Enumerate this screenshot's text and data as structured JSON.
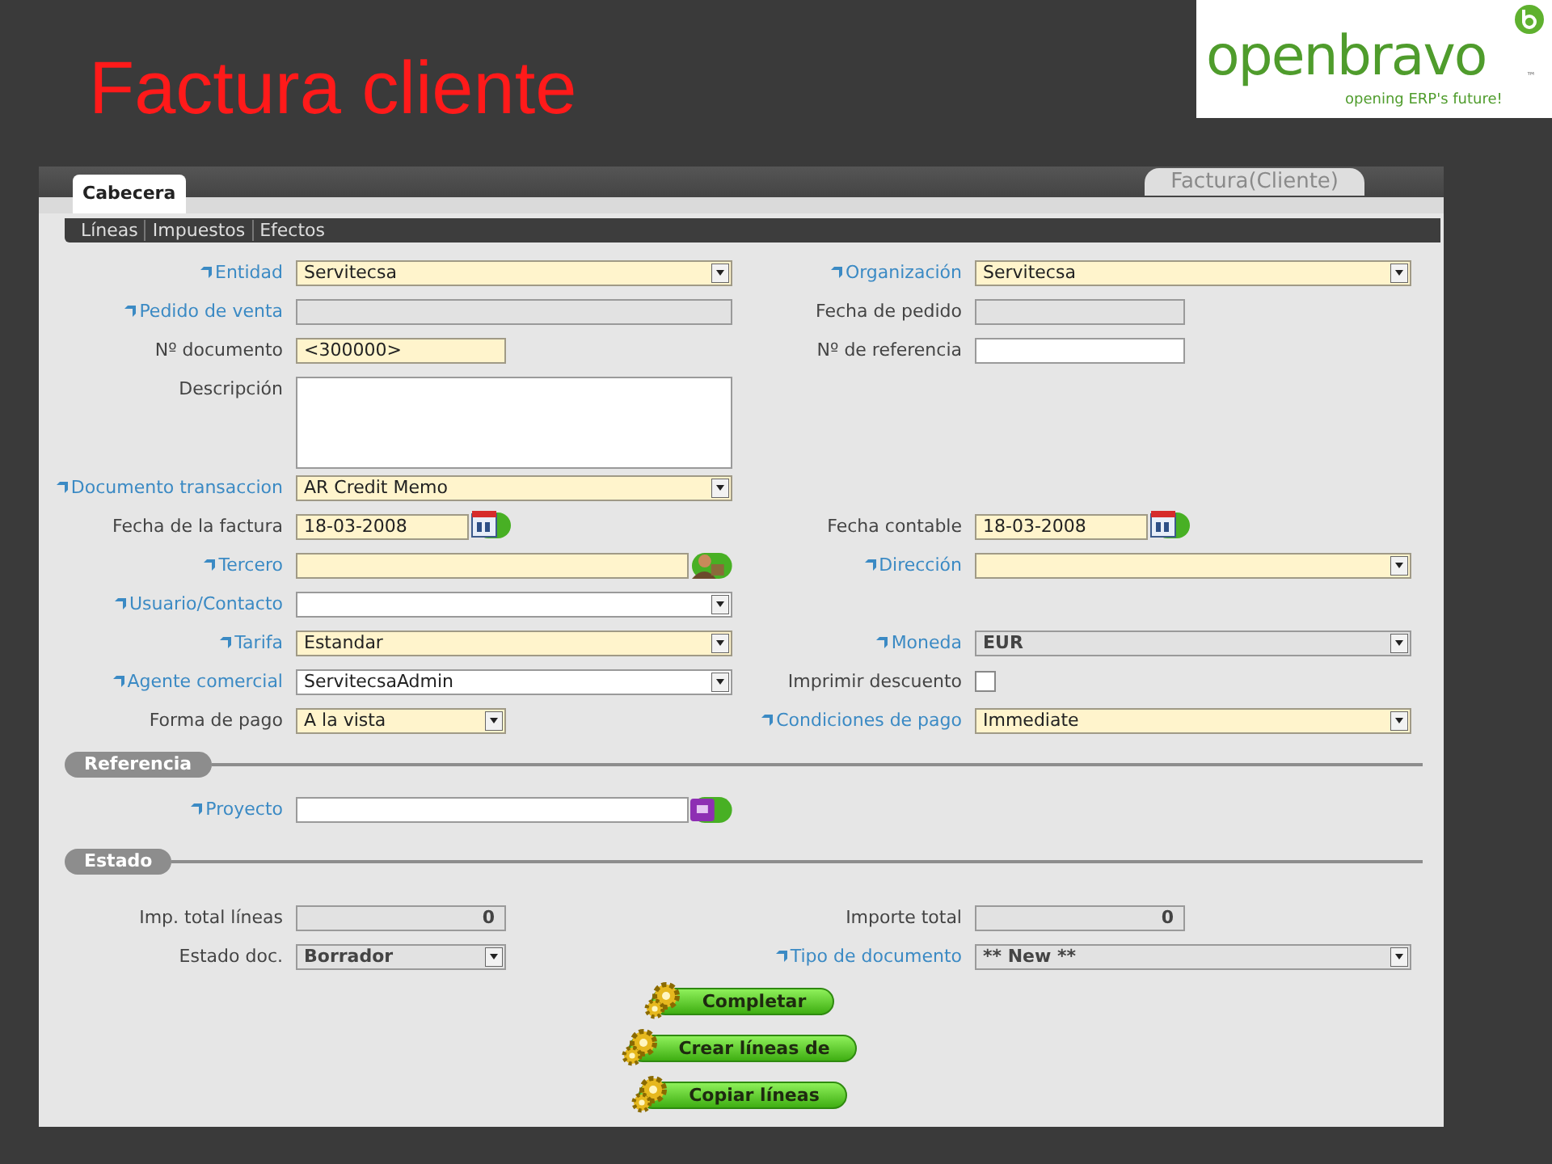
{
  "slide": {
    "title": "Factura cliente"
  },
  "logo": {
    "name": "openbravo",
    "trademark": "™",
    "tagline": "opening ERP's future!"
  },
  "window": {
    "tabs": [
      {
        "label": "Cabecera",
        "selected": true
      }
    ],
    "window_title": "Factura(Cliente)",
    "subtabs": [
      "Líneas",
      "Impuestos",
      "Efectos"
    ]
  },
  "sections": [
    {
      "rows": [
        {
          "left": {
            "label": "Entidad",
            "link": true,
            "kind": "select",
            "value": "Servitecsa",
            "mandatory": true,
            "readonly": false
          },
          "right": {
            "label": "Organización",
            "link": true,
            "kind": "select",
            "value": "Servitecsa",
            "mandatory": true,
            "readonly": false
          }
        },
        {
          "left": {
            "label": "Pedido de venta",
            "link": true,
            "kind": "text",
            "readonly": true
          },
          "right": {
            "label": "Fecha de pedido",
            "link": false,
            "kind": "text",
            "readonly": true
          }
        },
        {
          "left": {
            "label": "Nº documento",
            "link": false,
            "kind": "text",
            "value": "<300000>",
            "mandatory": true,
            "readonly": false
          },
          "right": {
            "label": "Nº de referencia",
            "link": false,
            "kind": "text",
            "mandatory": false,
            "readonly": false
          }
        },
        {
          "left": {
            "label": "Descripción",
            "link": false,
            "kind": "textarea",
            "mandatory": false,
            "readonly": false
          }
        },
        {
          "left": {
            "label": "Documento transaccion",
            "link": true,
            "kind": "select",
            "value": "AR Credit Memo",
            "mandatory": true,
            "readonly": false
          }
        },
        {
          "left": {
            "label": "Fecha de la factura",
            "link": false,
            "kind": "date",
            "value": "18-03-2008",
            "mandatory": true,
            "readonly": false
          },
          "right": {
            "label": "Fecha contable",
            "link": false,
            "kind": "date",
            "value": "18-03-2008",
            "mandatory": true,
            "readonly": false
          }
        },
        {
          "left": {
            "label": "Tercero",
            "link": true,
            "kind": "lookup",
            "mandatory": true,
            "readonly": false
          },
          "right": {
            "label": "Dirección",
            "link": true,
            "kind": "select",
            "mandatory": true,
            "readonly": false
          }
        },
        {
          "left": {
            "label": "Usuario/Contacto",
            "link": true,
            "kind": "select",
            "mandatory": false,
            "readonly": false
          }
        },
        {
          "left": {
            "label": "Tarifa",
            "link": true,
            "kind": "select",
            "value": "Estandar",
            "mandatory": true,
            "readonly": false
          },
          "right": {
            "label": "Moneda",
            "link": true,
            "kind": "select",
            "value": "EUR",
            "readonly": true
          }
        },
        {
          "left": {
            "label": "Agente comercial",
            "link": true,
            "kind": "select",
            "value": "ServitecsaAdmin",
            "mandatory": false,
            "readonly": false
          },
          "right": {
            "label": "Imprimir descuento",
            "link": false,
            "kind": "checkbox",
            "checked": false
          }
        },
        {
          "left": {
            "label": "Forma de pago",
            "link": false,
            "kind": "select",
            "value": "A la vista",
            "mandatory": true,
            "readonly": false
          },
          "right": {
            "label": "Condiciones de pago",
            "link": true,
            "kind": "select",
            "value": "Immediate",
            "mandatory": true,
            "readonly": false
          }
        }
      ]
    },
    {
      "title": "Referencia",
      "rows": [
        {
          "left": {
            "label": "Proyecto",
            "link": true,
            "kind": "lookup",
            "mandatory": false,
            "readonly": false
          }
        }
      ]
    },
    {
      "title": "Estado",
      "rows": [
        {
          "left": {
            "label": "Imp. total líneas",
            "link": false,
            "kind": "number",
            "value": "0",
            "readonly": true
          },
          "right": {
            "label": "Importe total",
            "link": false,
            "kind": "number",
            "value": "0",
            "readonly": true
          }
        },
        {
          "left": {
            "label": "Estado doc.",
            "link": false,
            "kind": "select",
            "value": "Borrador",
            "readonly": true
          },
          "right": {
            "label": "Tipo de documento",
            "link": true,
            "kind": "select",
            "value": "** New **",
            "readonly": true
          }
        }
      ]
    }
  ],
  "buttons": [
    "Completar",
    "Crear líneas de",
    "Copiar líneas"
  ]
}
